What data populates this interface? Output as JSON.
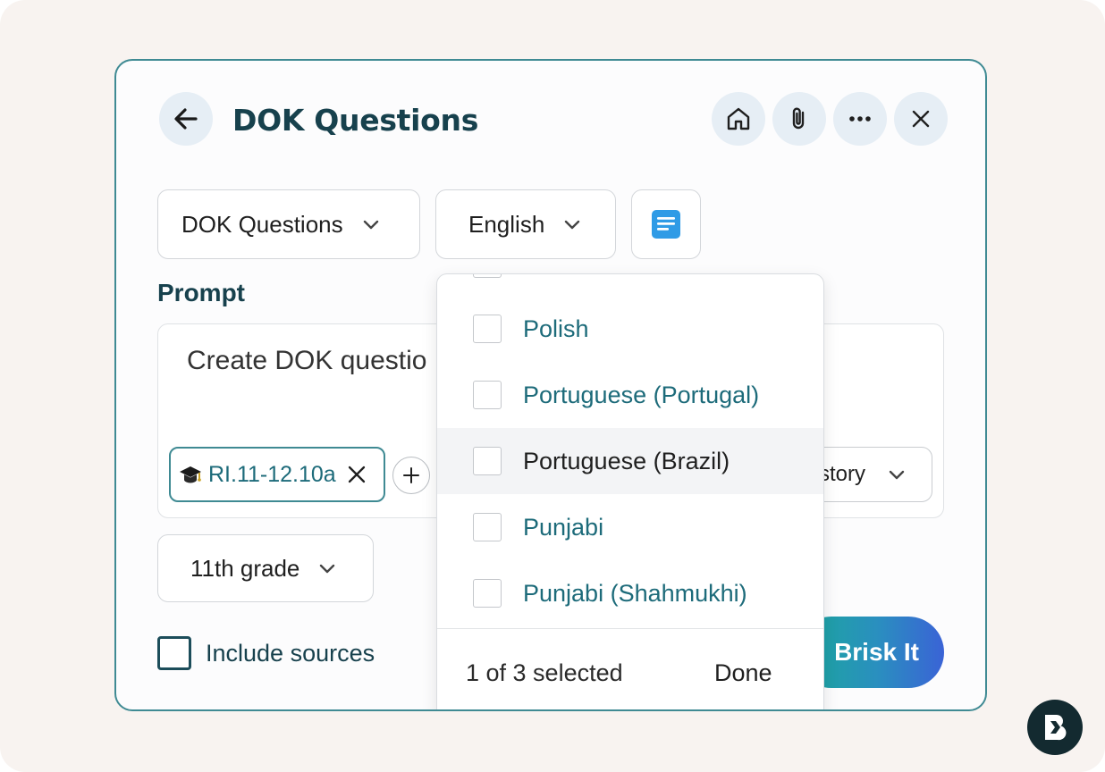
{
  "header": {
    "title": "DOK Questions",
    "back_icon": "arrow-left-icon",
    "actions": [
      "home-icon",
      "paperclip-icon",
      "more-horizontal-icon",
      "close-icon"
    ]
  },
  "controls": {
    "tool_select": "DOK Questions",
    "language_select": "English",
    "document_icon": "document-icon"
  },
  "prompt": {
    "label": "Prompt",
    "text": "Create DOK questio",
    "standard_tag": "RI.11-12.10a",
    "subject_partial": "story"
  },
  "grade_select": "11th grade",
  "include_sources_label": "Include sources",
  "submit_label": "Brisk It",
  "language_dropdown": {
    "options": [
      {
        "label": "Polish",
        "checked": false,
        "highlighted": false
      },
      {
        "label": "Portuguese (Portugal)",
        "checked": false,
        "highlighted": false
      },
      {
        "label": "Portuguese (Brazil)",
        "checked": false,
        "highlighted": true
      },
      {
        "label": "Punjabi",
        "checked": false,
        "highlighted": false
      },
      {
        "label": "Punjabi (Shahmukhi)",
        "checked": false,
        "highlighted": false
      }
    ],
    "selection_status": "1 of 3 selected",
    "done_label": "Done"
  },
  "colors": {
    "accent": "#3f8a93",
    "heading": "#17414d",
    "option_text": "#1d6b7a",
    "doc_icon": "#2f9be6"
  }
}
